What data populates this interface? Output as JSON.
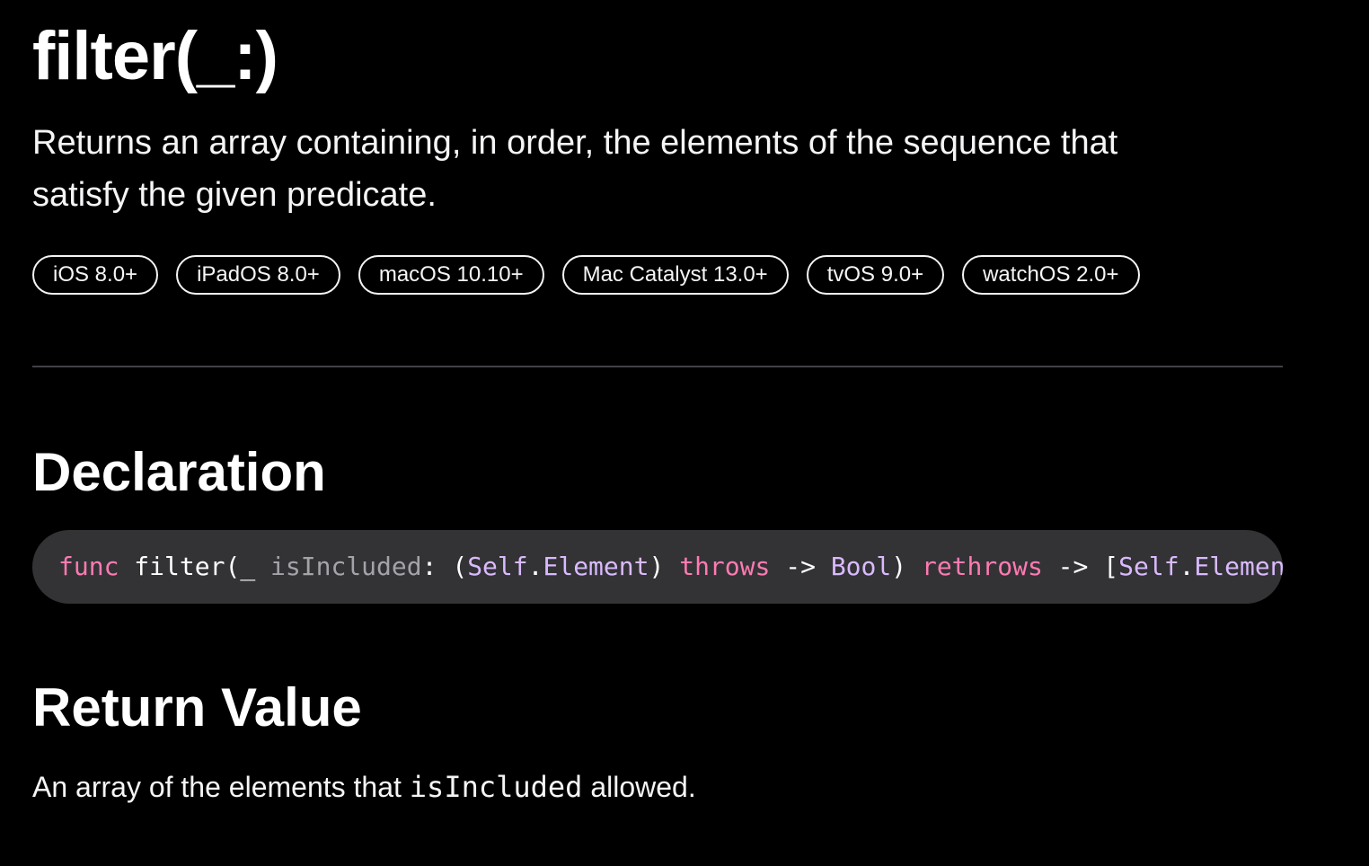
{
  "title": "filter(_:)",
  "abstract": "Returns an array containing, in order, the elements of the sequence that satisfy the given predicate.",
  "availability": [
    "iOS 8.0+",
    "iPadOS 8.0+",
    "macOS 10.10+",
    "Mac Catalyst 13.0+",
    "tvOS 9.0+",
    "watchOS 2.0+"
  ],
  "declaration": {
    "heading": "Declaration",
    "tokens": {
      "func": "func",
      "name": "filter",
      "open_paren": "(",
      "underscore": "_ ",
      "param": "isIncluded",
      "colon": ": (",
      "self1": "Self",
      "dot1": ".",
      "element1": "Element",
      "close1": ") ",
      "throws": "throws",
      "arrow1": " -> ",
      "bool": "Bool",
      "close2": ") ",
      "rethrows": "rethrows",
      "arrow2": " -> [",
      "self2": "Self",
      "dot2": ".",
      "element2": "Element",
      "close3": "]"
    }
  },
  "return_value": {
    "heading": "Return Value",
    "text_before": "An array of the elements that ",
    "code": "isIncluded",
    "text_after": " allowed."
  },
  "colors": {
    "background": "#000000",
    "text": "#f5f5f7",
    "code_background": "#333336",
    "keyword": "#ff7ab2",
    "type": "#dabaff",
    "parameter": "#a3a3a8",
    "divider": "#424245"
  }
}
